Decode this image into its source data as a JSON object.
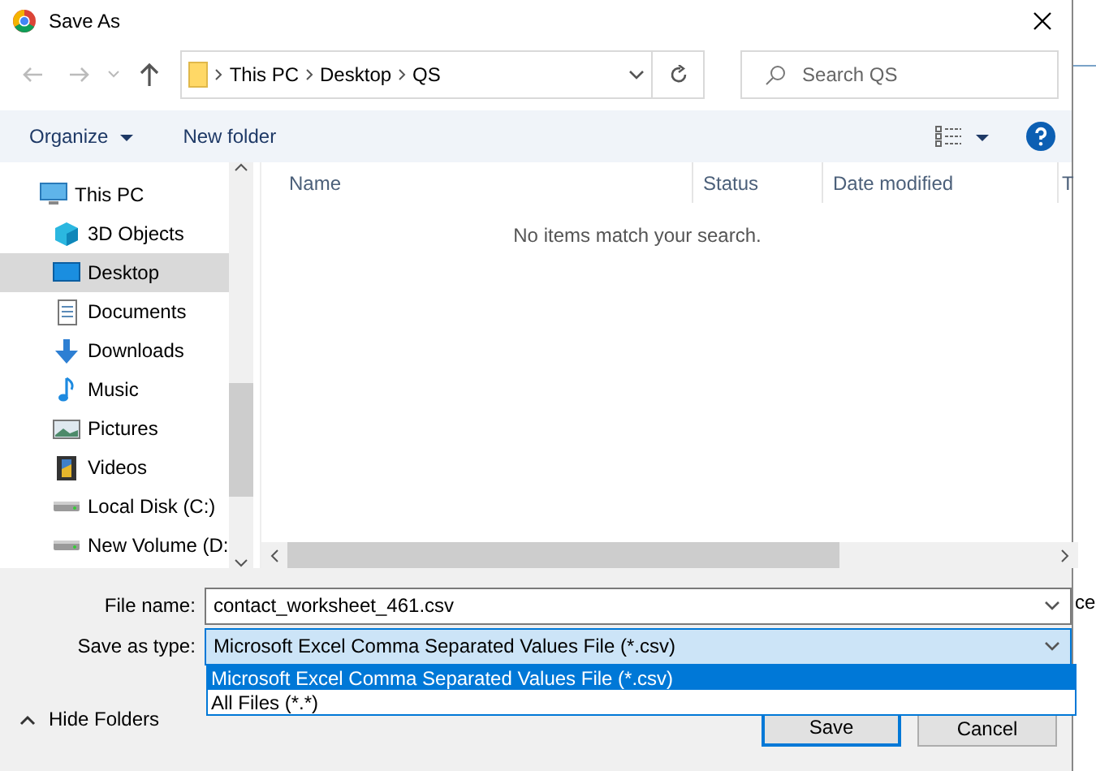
{
  "window": {
    "title": "Save As"
  },
  "address": {
    "crumbs": [
      "This PC",
      "Desktop",
      "QS"
    ]
  },
  "search": {
    "placeholder": "Search QS"
  },
  "toolbar": {
    "organize": "Organize",
    "new_folder": "New folder"
  },
  "sidebar": {
    "items": [
      {
        "label": "This PC",
        "kind": "pc",
        "selected": false
      },
      {
        "label": "3D Objects",
        "kind": "cube",
        "selected": false
      },
      {
        "label": "Desktop",
        "kind": "desktop",
        "selected": true
      },
      {
        "label": "Documents",
        "kind": "document",
        "selected": false
      },
      {
        "label": "Downloads",
        "kind": "download",
        "selected": false
      },
      {
        "label": "Music",
        "kind": "music",
        "selected": false
      },
      {
        "label": "Pictures",
        "kind": "pictures",
        "selected": false
      },
      {
        "label": "Videos",
        "kind": "video",
        "selected": false
      },
      {
        "label": "Local Disk (C:)",
        "kind": "drive",
        "selected": false
      },
      {
        "label": "New Volume (D:",
        "kind": "drive",
        "selected": false
      }
    ]
  },
  "table": {
    "columns": [
      "Name",
      "Status",
      "Date modified",
      "T"
    ],
    "empty_message": "No items match your search."
  },
  "form": {
    "file_name_label": "File name:",
    "file_name": "contact_worksheet_461.csv",
    "type_label": "Save as type:",
    "type_value": "Microsoft Excel Comma Separated Values File (*.csv)",
    "type_options": [
      {
        "label": "Microsoft Excel Comma Separated Values File (*.csv)",
        "selected": true
      },
      {
        "label": "All Files (*.*)",
        "selected": false
      }
    ]
  },
  "hide_folders": "Hide Folders",
  "buttons": [
    "Save",
    "Cancel"
  ],
  "background_text": "ce"
}
